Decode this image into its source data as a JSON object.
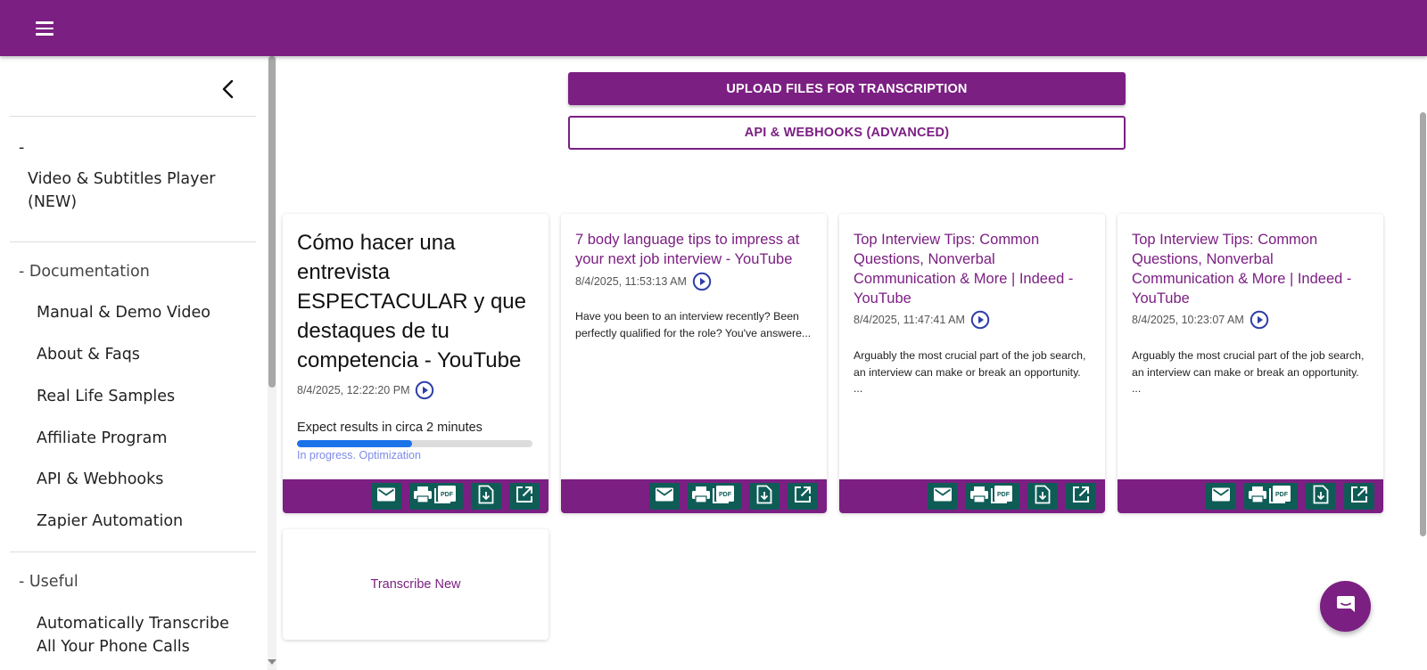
{
  "header": {
    "menu_icon": "hamburger-menu-icon"
  },
  "sidebar": {
    "collapse_icon": "chevron-left-icon",
    "top_dash": "-",
    "video_player_label": "Video & Subtitles Player (NEW)",
    "documentation_header": "- Documentation",
    "documentation_items": [
      {
        "label": "Manual & Demo Video"
      },
      {
        "label": "About & Faqs"
      },
      {
        "label": "Real Life Samples"
      },
      {
        "label": "Affiliate Program"
      },
      {
        "label": "API & Webhooks"
      },
      {
        "label": "Zapier Automation"
      }
    ],
    "useful_header": "- Useful",
    "useful_items": [
      {
        "label": "Automatically Transcribe All Your Phone Calls"
      }
    ]
  },
  "main": {
    "upload_button": "UPLOAD FILES FOR TRANSCRIPTION",
    "api_button": "API & WEBHOOKS (ADVANCED)",
    "cards": [
      {
        "title": "Cómo hacer una entrevista ESPECTACULAR y que destaques de tu competencia - YouTube",
        "date": "8/4/2025, 12:22:20 PM",
        "progress_label": "Expect results in circa 2 minutes",
        "progress_fraction": 0.49,
        "progress_status": "In progress. Optimization"
      },
      {
        "title": "7 body language tips to impress at your next job interview - YouTube",
        "date": "8/4/2025, 11:53:13 AM",
        "description": "Have you been to an interview recently? Been perfectly qualified for the role? You've answere..."
      },
      {
        "title": "Top Interview Tips: Common Questions, Nonverbal Communication & More | Indeed - YouTube",
        "date": "8/4/2025, 11:47:41 AM",
        "description": "Arguably the most crucial part of the job search, an interview can make or break an opportunity. ..."
      },
      {
        "title": "Top Interview Tips: Common Questions, Nonverbal Communication & More | Indeed - YouTube",
        "date": "8/4/2025, 10:23:07 AM",
        "description": "Arguably the most crucial part of the job search, an interview can make or break an opportunity. ..."
      }
    ],
    "card_actions": [
      "email-icon",
      "print-pdf-icon",
      "download-icon",
      "open-external-icon"
    ],
    "transcribe_new": "Transcribe New"
  },
  "chat": {
    "icon": "chat-bubble-icon"
  },
  "colors": {
    "brand": "#7b1f82",
    "action": "#0f5c57",
    "progress": "#1a73e8",
    "play": "#2f3fa8"
  }
}
